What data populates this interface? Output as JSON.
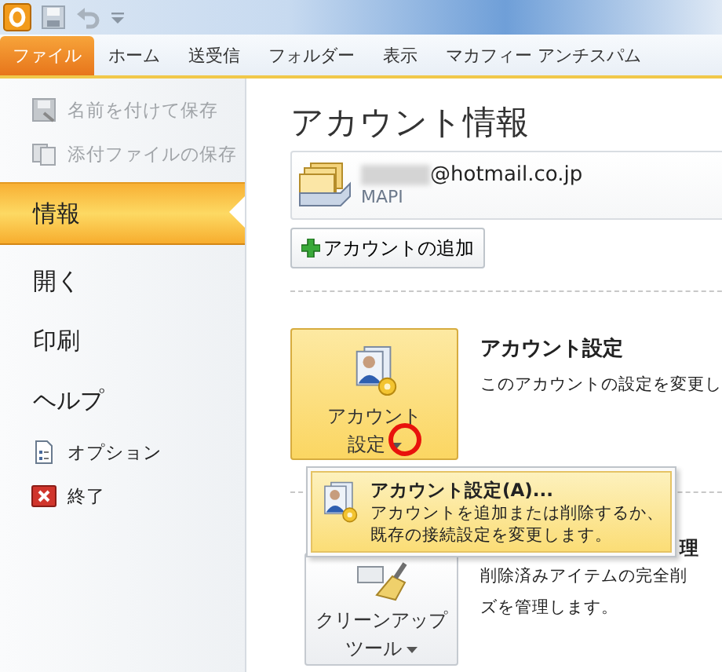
{
  "quick_access": {
    "tools": [
      {
        "kind": "app"
      },
      {
        "kind": "save"
      },
      {
        "kind": "undo"
      },
      {
        "kind": "customize"
      }
    ]
  },
  "tabs": [
    {
      "label": "ファイル",
      "selected": true
    },
    {
      "label": "ホーム",
      "selected": false
    },
    {
      "label": "送受信",
      "selected": false
    },
    {
      "label": "フォルダー",
      "selected": false
    },
    {
      "label": "表示",
      "selected": false
    },
    {
      "label": "マカフィー アンチスパム",
      "selected": false
    }
  ],
  "sidebar": {
    "items": [
      {
        "kind": "saveas",
        "label": "名前を付けて保存",
        "disabled": true,
        "selected": false
      },
      {
        "kind": "attachments",
        "label": "添付ファイルの保存",
        "disabled": true,
        "selected": false
      },
      {
        "kind": "page",
        "label": "情報",
        "disabled": false,
        "selected": true
      },
      {
        "kind": "page",
        "label": "開く",
        "disabled": false,
        "selected": false
      },
      {
        "kind": "page",
        "label": "印刷",
        "disabled": false,
        "selected": false
      },
      {
        "kind": "page",
        "label": "ヘルプ",
        "disabled": false,
        "selected": false
      },
      {
        "kind": "options",
        "label": "オプション",
        "disabled": false,
        "selected": false
      },
      {
        "kind": "exit",
        "label": "終了",
        "disabled": false,
        "selected": false
      }
    ]
  },
  "main": {
    "title": "アカウント情報",
    "account": {
      "address": "@hotmail.co.jp",
      "type": "MAPI"
    },
    "add_account_button": "アカウントの追加",
    "sections": [
      {
        "kind": "settings",
        "button": "アカウント設定",
        "title": "アカウント設定",
        "description": [
          "このアカウントの設定を変更し"
        ],
        "pressed": true
      },
      {
        "kind": "cleanup",
        "button": "クリーンアップツール",
        "title": "理",
        "description": [
          "削除済みアイテムの完全削",
          "ズを管理します。"
        ],
        "pressed": false
      }
    ],
    "dropdown_menu": {
      "items": [
        {
          "title": "アカウント設定(A)...",
          "description": [
            "アカウントを追加または削除するか、",
            "既存の接続設定を変更します。"
          ],
          "highlighted": true
        }
      ]
    }
  }
}
